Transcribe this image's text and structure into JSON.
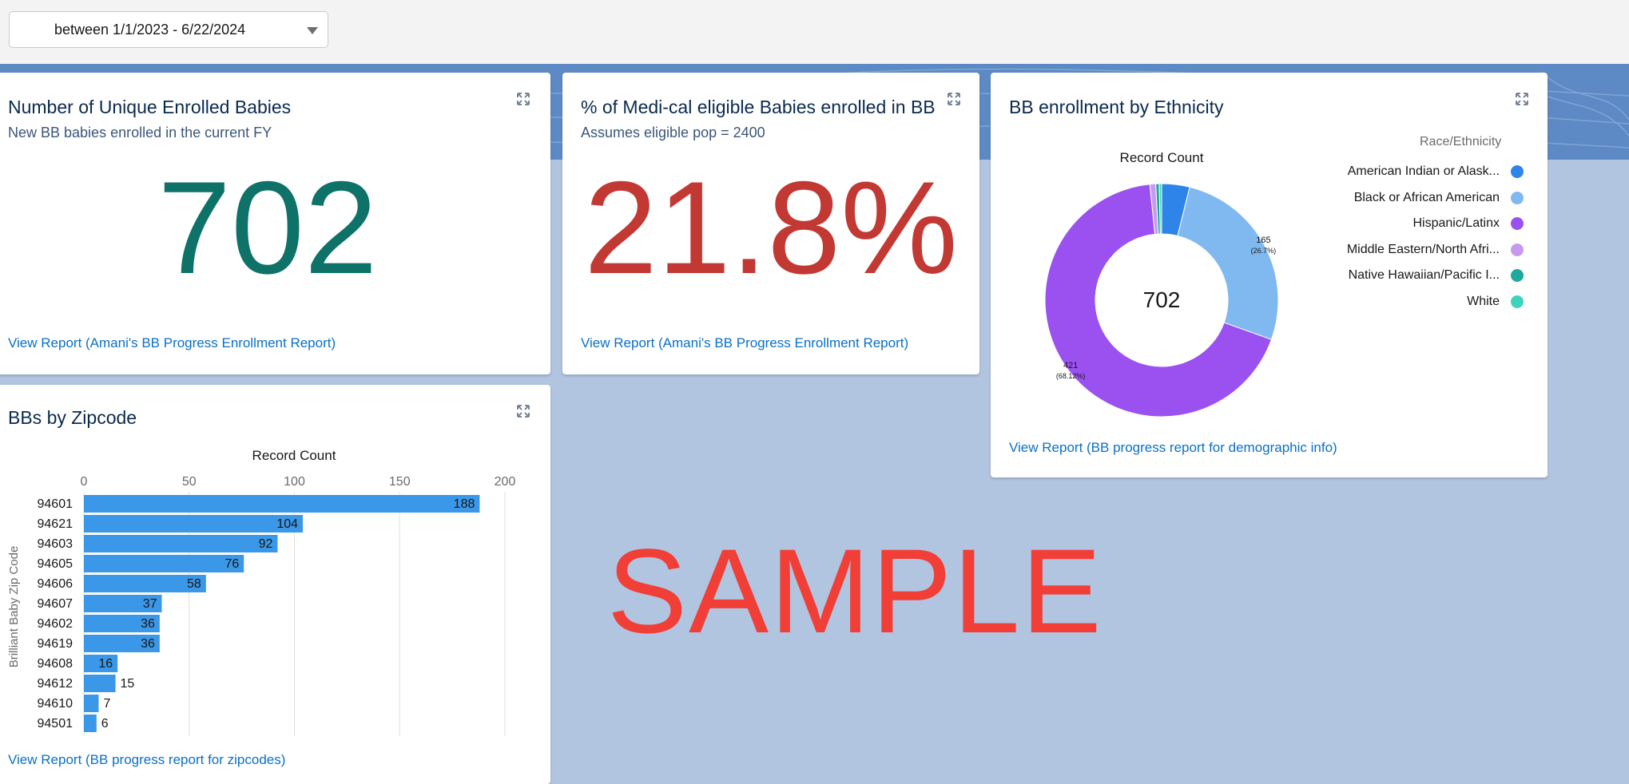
{
  "filter": {
    "label": "between 1/1/2023 - 6/22/2024"
  },
  "icons": {
    "expand": "expand-icon",
    "dropdown": "chevron-down-icon"
  },
  "colors": {
    "teal_metric": "#0e7268",
    "red_metric": "#c23934",
    "bar": "#3b97e8",
    "link": "#0a70c5",
    "sample_watermark": "#f13e36"
  },
  "cards": {
    "enrolled": {
      "title": "Number of Unique Enrolled Babies",
      "subtitle": "New BB babies enrolled in the current FY",
      "value": "702",
      "link": "View Report (Amani's BB Progress Enrollment Report)"
    },
    "medical": {
      "title": "% of Medi-cal eligible Babies enrolled in BB",
      "subtitle": "Assumes eligible pop = 2400",
      "value": "21.8%",
      "link": "View Report (Amani's BB Progress Enrollment Report)"
    },
    "ethnicity": {
      "title": "BB enrollment by Ethnicity",
      "link": "View Report (BB progress report for demographic info)"
    },
    "zipcode": {
      "title": "BBs by Zipcode",
      "link": "View Report (BB progress report for zipcodes)"
    }
  },
  "watermark": "SAMPLE",
  "chart_data": [
    {
      "type": "donut",
      "title": "Record Count",
      "center_label": "702",
      "legend_title": "Race/Ethnicity",
      "legend_position": "right",
      "categories": [
        "American Indian or Alask...",
        "Black or African American",
        "Hispanic/Latinx",
        "Middle Eastern/North Afri...",
        "Native Hawaiian/Pacific I...",
        "White"
      ],
      "colors": [
        "#2e84e8",
        "#7fb9f0",
        "#9b51f0",
        "#c79af0",
        "#1fa89c",
        "#3fd3be"
      ],
      "values": [
        24,
        165,
        421,
        5,
        3,
        2
      ],
      "data_labels": [
        {
          "category": "Black or African American",
          "count": "165",
          "percent": "(26.7%)"
        },
        {
          "category": "Hispanic/Latinx",
          "count": "421",
          "percent": "(68.12%)"
        }
      ]
    },
    {
      "type": "bar",
      "orientation": "horizontal",
      "title": "Record Count",
      "ylabel": "Brilliant Baby Zip Code",
      "xlim": [
        0,
        200
      ],
      "xticks": [
        "0",
        "50",
        "100",
        "150",
        "200"
      ],
      "grid": true,
      "categories": [
        "94601",
        "94621",
        "94603",
        "94605",
        "94606",
        "94607",
        "94602",
        "94619",
        "94608",
        "94612",
        "94610",
        "94501"
      ],
      "values": [
        188,
        104,
        92,
        76,
        58,
        37,
        36,
        36,
        16,
        15,
        7,
        6
      ]
    }
  ]
}
